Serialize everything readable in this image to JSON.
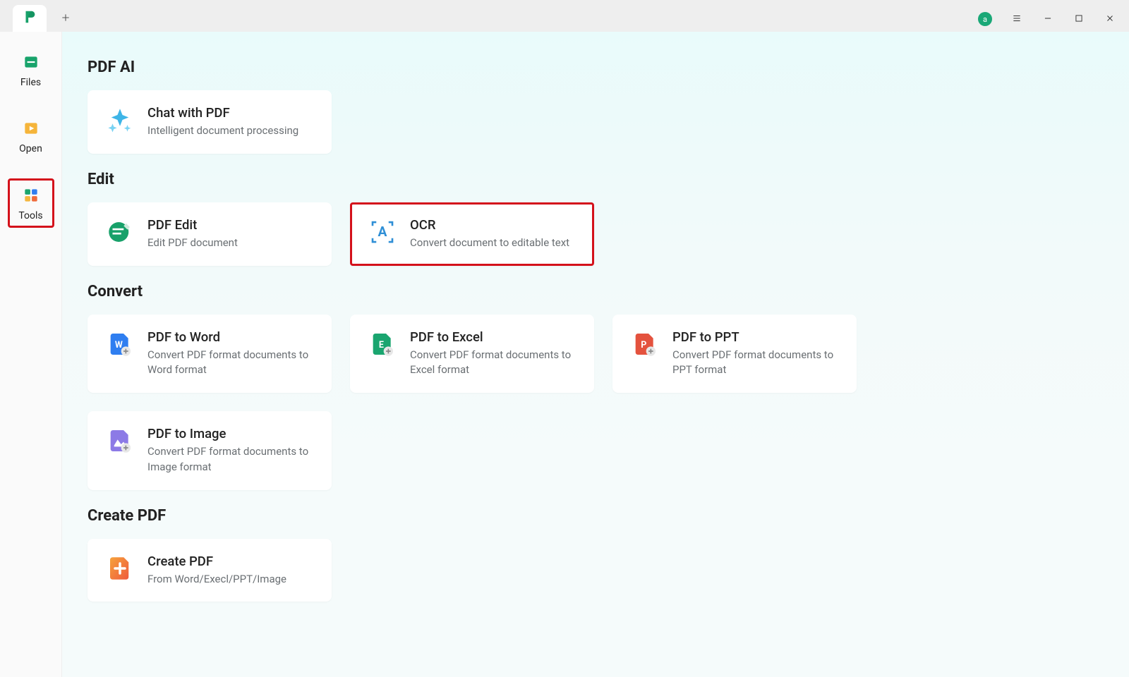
{
  "titlebar": {
    "avatar_letter": "a"
  },
  "sidebar": {
    "items": [
      {
        "label": "Files"
      },
      {
        "label": "Open"
      },
      {
        "label": "Tools"
      }
    ]
  },
  "sections": {
    "pdf_ai": {
      "heading": "PDF AI",
      "chat": {
        "title": "Chat with PDF",
        "desc": "Intelligent document processing"
      }
    },
    "edit": {
      "heading": "Edit",
      "pdf_edit": {
        "title": "PDF Edit",
        "desc": "Edit PDF document"
      },
      "ocr": {
        "title": "OCR",
        "desc": "Convert document to editable text"
      }
    },
    "convert": {
      "heading": "Convert",
      "word": {
        "title": "PDF to Word",
        "desc": "Convert PDF format documents to Word format"
      },
      "excel": {
        "title": "PDF to Excel",
        "desc": "Convert PDF format documents to Excel format"
      },
      "ppt": {
        "title": "PDF to PPT",
        "desc": "Convert PDF format documents to PPT format"
      },
      "image": {
        "title": "PDF to Image",
        "desc": "Convert PDF format documents to Image format"
      }
    },
    "create": {
      "heading": "Create PDF",
      "create": {
        "title": "Create PDF",
        "desc": "From Word/Execl/PPT/Image"
      }
    }
  }
}
